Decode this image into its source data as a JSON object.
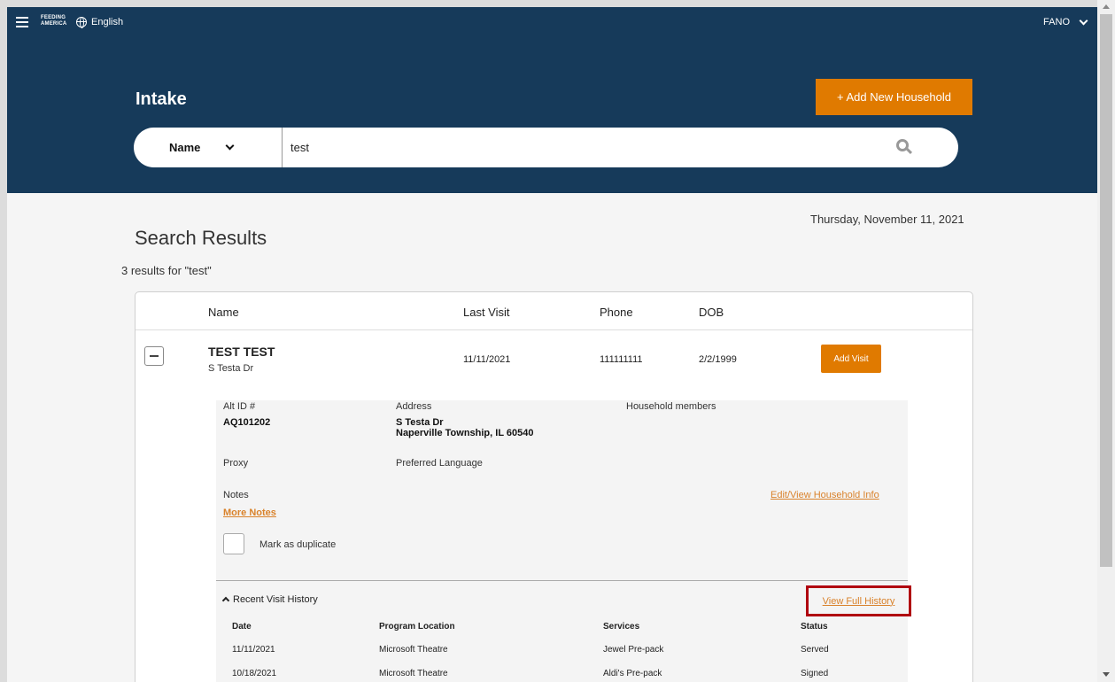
{
  "header": {
    "logo_line1": "FEEDING",
    "logo_line2": "AMERICA",
    "language": "English",
    "user": "FANO",
    "title": "Intake",
    "add_household": "+ Add New Household"
  },
  "search": {
    "field": "Name",
    "value": "test"
  },
  "results": {
    "date": "Thursday, November 11, 2021",
    "title": "Search Results",
    "count": "3 results for \"test\"",
    "columns": [
      "Name",
      "Last Visit",
      "Phone",
      "DOB"
    ]
  },
  "household": {
    "name": "TEST TEST",
    "address_short": "S Testa Dr",
    "last_visit": "11/11/2021",
    "phone": "111111111",
    "dob": "2/2/1999",
    "add_visit": "Add Visit",
    "alt_id_label": "Alt ID #",
    "alt_id": "AQ101202",
    "address_label": "Address",
    "address_line1": "S Testa Dr",
    "address_line2": "Naperville Township, IL 60540",
    "members_label": "Household members",
    "proxy_label": "Proxy",
    "language_label": "Preferred Language",
    "notes_label": "Notes",
    "more_notes": "More Notes",
    "edit_view": "Edit/View Household Info",
    "mark_duplicate": "Mark as duplicate"
  },
  "history": {
    "title": "Recent Visit History",
    "view_full": "View Full History",
    "columns": [
      "Date",
      "Program Location",
      "Services",
      "Status"
    ],
    "rows": [
      {
        "date": "11/11/2021",
        "location": "Microsoft Theatre",
        "services": "Jewel Pre-pack",
        "status": "Served"
      },
      {
        "date": "10/18/2021",
        "location": "Microsoft Theatre",
        "services": "Aldi's Pre-pack",
        "status": "Signed"
      }
    ]
  },
  "colors": {
    "header_bg": "#163a5a",
    "accent": "#e07a00",
    "link": "#d9822b",
    "highlight": "#b00010"
  }
}
